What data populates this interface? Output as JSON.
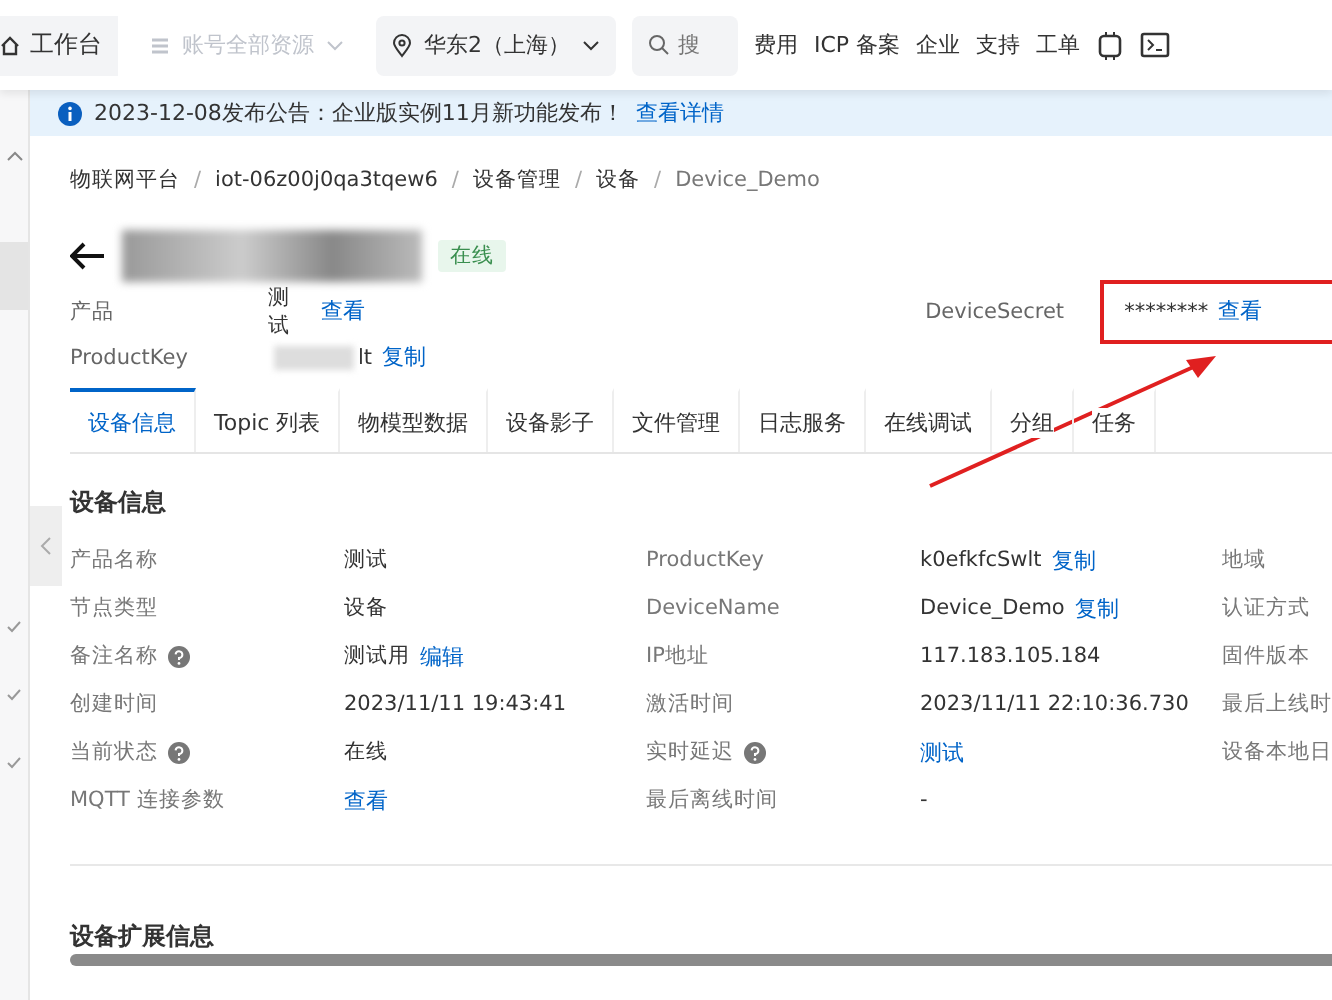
{
  "topbar": {
    "home": "工作台",
    "resources": {
      "label": "账号全部资源",
      "disabled": true
    },
    "region": "华东2（上海）",
    "search": {
      "placeholder": "搜"
    },
    "links": [
      "费用",
      "ICP 备案",
      "企业",
      "支持",
      "工单"
    ]
  },
  "notice": {
    "text": "2023-12-08发布公告：企业版实例11月新功能发布！",
    "link": "查看详情"
  },
  "breadcrumb": {
    "separator": "/",
    "items": [
      "物联网平台",
      "iot-06z00j0qa3tqew6",
      "设备管理",
      "设备",
      "Device_Demo"
    ]
  },
  "header": {
    "status": "在线",
    "product_label": "产品",
    "product_value": "测试",
    "product_link": "查看",
    "productkey_label": "ProductKey",
    "productkey_value": "lt",
    "productkey_link": "复制",
    "secret_label": "DeviceSecret",
    "secret_value": "********",
    "secret_link": "查看"
  },
  "tabs": [
    {
      "label": "设备信息",
      "selected": true
    },
    {
      "label": "Topic 列表",
      "selected": false
    },
    {
      "label": "物模型数据",
      "selected": false
    },
    {
      "label": "设备影子",
      "selected": false
    },
    {
      "label": "文件管理",
      "selected": false
    },
    {
      "label": "日志服务",
      "selected": false
    },
    {
      "label": "在线调试",
      "selected": false
    },
    {
      "label": "分组",
      "selected": false
    },
    {
      "label": "任务",
      "selected": false
    }
  ],
  "info": {
    "title": "设备信息",
    "rows": [
      {
        "cells": [
          {
            "label": "产品名称",
            "value": "测试"
          },
          {
            "label": "ProductKey",
            "value": "k0efkfcSwlt",
            "link": "复制"
          },
          {
            "label": "地域"
          }
        ]
      },
      {
        "cells": [
          {
            "label": "节点类型",
            "value": "设备"
          },
          {
            "label": "DeviceName",
            "value": "Device_Demo",
            "link": "复制"
          },
          {
            "label": "认证方式"
          }
        ]
      },
      {
        "cells": [
          {
            "label": "备注名称",
            "help": true,
            "value": "测试用",
            "link": "编辑"
          },
          {
            "label": "IP地址",
            "value": "117.183.105.184"
          },
          {
            "label": "固件版本"
          }
        ]
      },
      {
        "cells": [
          {
            "label": "创建时间",
            "value": "2023/11/11 19:43:41"
          },
          {
            "label": "激活时间",
            "value": "2023/11/11 22:10:36.730"
          },
          {
            "label": "最后上线时"
          }
        ]
      },
      {
        "cells": [
          {
            "label": "当前状态",
            "help": true,
            "value": "在线"
          },
          {
            "label": "实时延迟",
            "help": true,
            "link": "测试"
          },
          {
            "label": "设备本地日"
          }
        ]
      },
      {
        "cells": [
          {
            "label": "MQTT 连接参数",
            "link": "查看"
          },
          {
            "label": "最后离线时间",
            "value": "-"
          }
        ]
      }
    ]
  },
  "ext_title": "设备扩展信息"
}
